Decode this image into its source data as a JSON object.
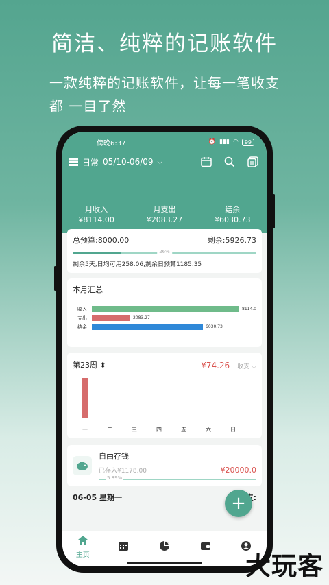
{
  "promo": {
    "title": "简洁、纯粹的记账软件",
    "subtitle_line1": "一款纯粹的记账软件，让每一笔收支",
    "subtitle_line2": "都 一目了然"
  },
  "status": {
    "time": "傍晚6:37",
    "battery": "99"
  },
  "nav": {
    "ledger": "日常",
    "range": "05/10-06/09"
  },
  "summary": {
    "income_label": "月收入",
    "income_value": "¥8114.00",
    "expense_label": "月支出",
    "expense_value": "¥2083.27",
    "balance_label": "结余",
    "balance_value": "¥6030.73"
  },
  "budget": {
    "total": "总预算:8000.00",
    "remaining": "剩余:5926.73",
    "percent_label": "26%",
    "percent": 0.26,
    "note": "剩余5天,日均可用258.06,剩余日预算1185.35"
  },
  "monthly": {
    "title": "本月汇总",
    "rows": [
      {
        "label": "收入",
        "value": "8114.0",
        "amount": 8114.0,
        "color": "#6fbb8a"
      },
      {
        "label": "支出",
        "value": "2083.27",
        "amount": 2083.27,
        "color": "#d66c6c"
      },
      {
        "label": "结余",
        "value": "6030.73",
        "amount": 6030.73,
        "color": "#2f88d8"
      }
    ]
  },
  "week": {
    "title": "第23周",
    "amount": "¥74.26",
    "filter": "收支",
    "days": [
      "一",
      "二",
      "三",
      "四",
      "五",
      "六",
      "日"
    ],
    "values": [
      74.26,
      0,
      0,
      0,
      0,
      0,
      0
    ],
    "bar_color": "#d66c6c"
  },
  "savings": {
    "title": "自由存钱",
    "saved": "已存入¥1178.00",
    "target": "¥20000.0",
    "percent_label": "5.89%",
    "percent": 0.0589
  },
  "dayrow": {
    "date": "06-05 星期一",
    "right": "支:"
  },
  "tabs": {
    "home_label": "主页"
  },
  "colors": {
    "accent": "#51a68f",
    "expense": "#d9534f"
  },
  "watermark": "大玩客"
}
